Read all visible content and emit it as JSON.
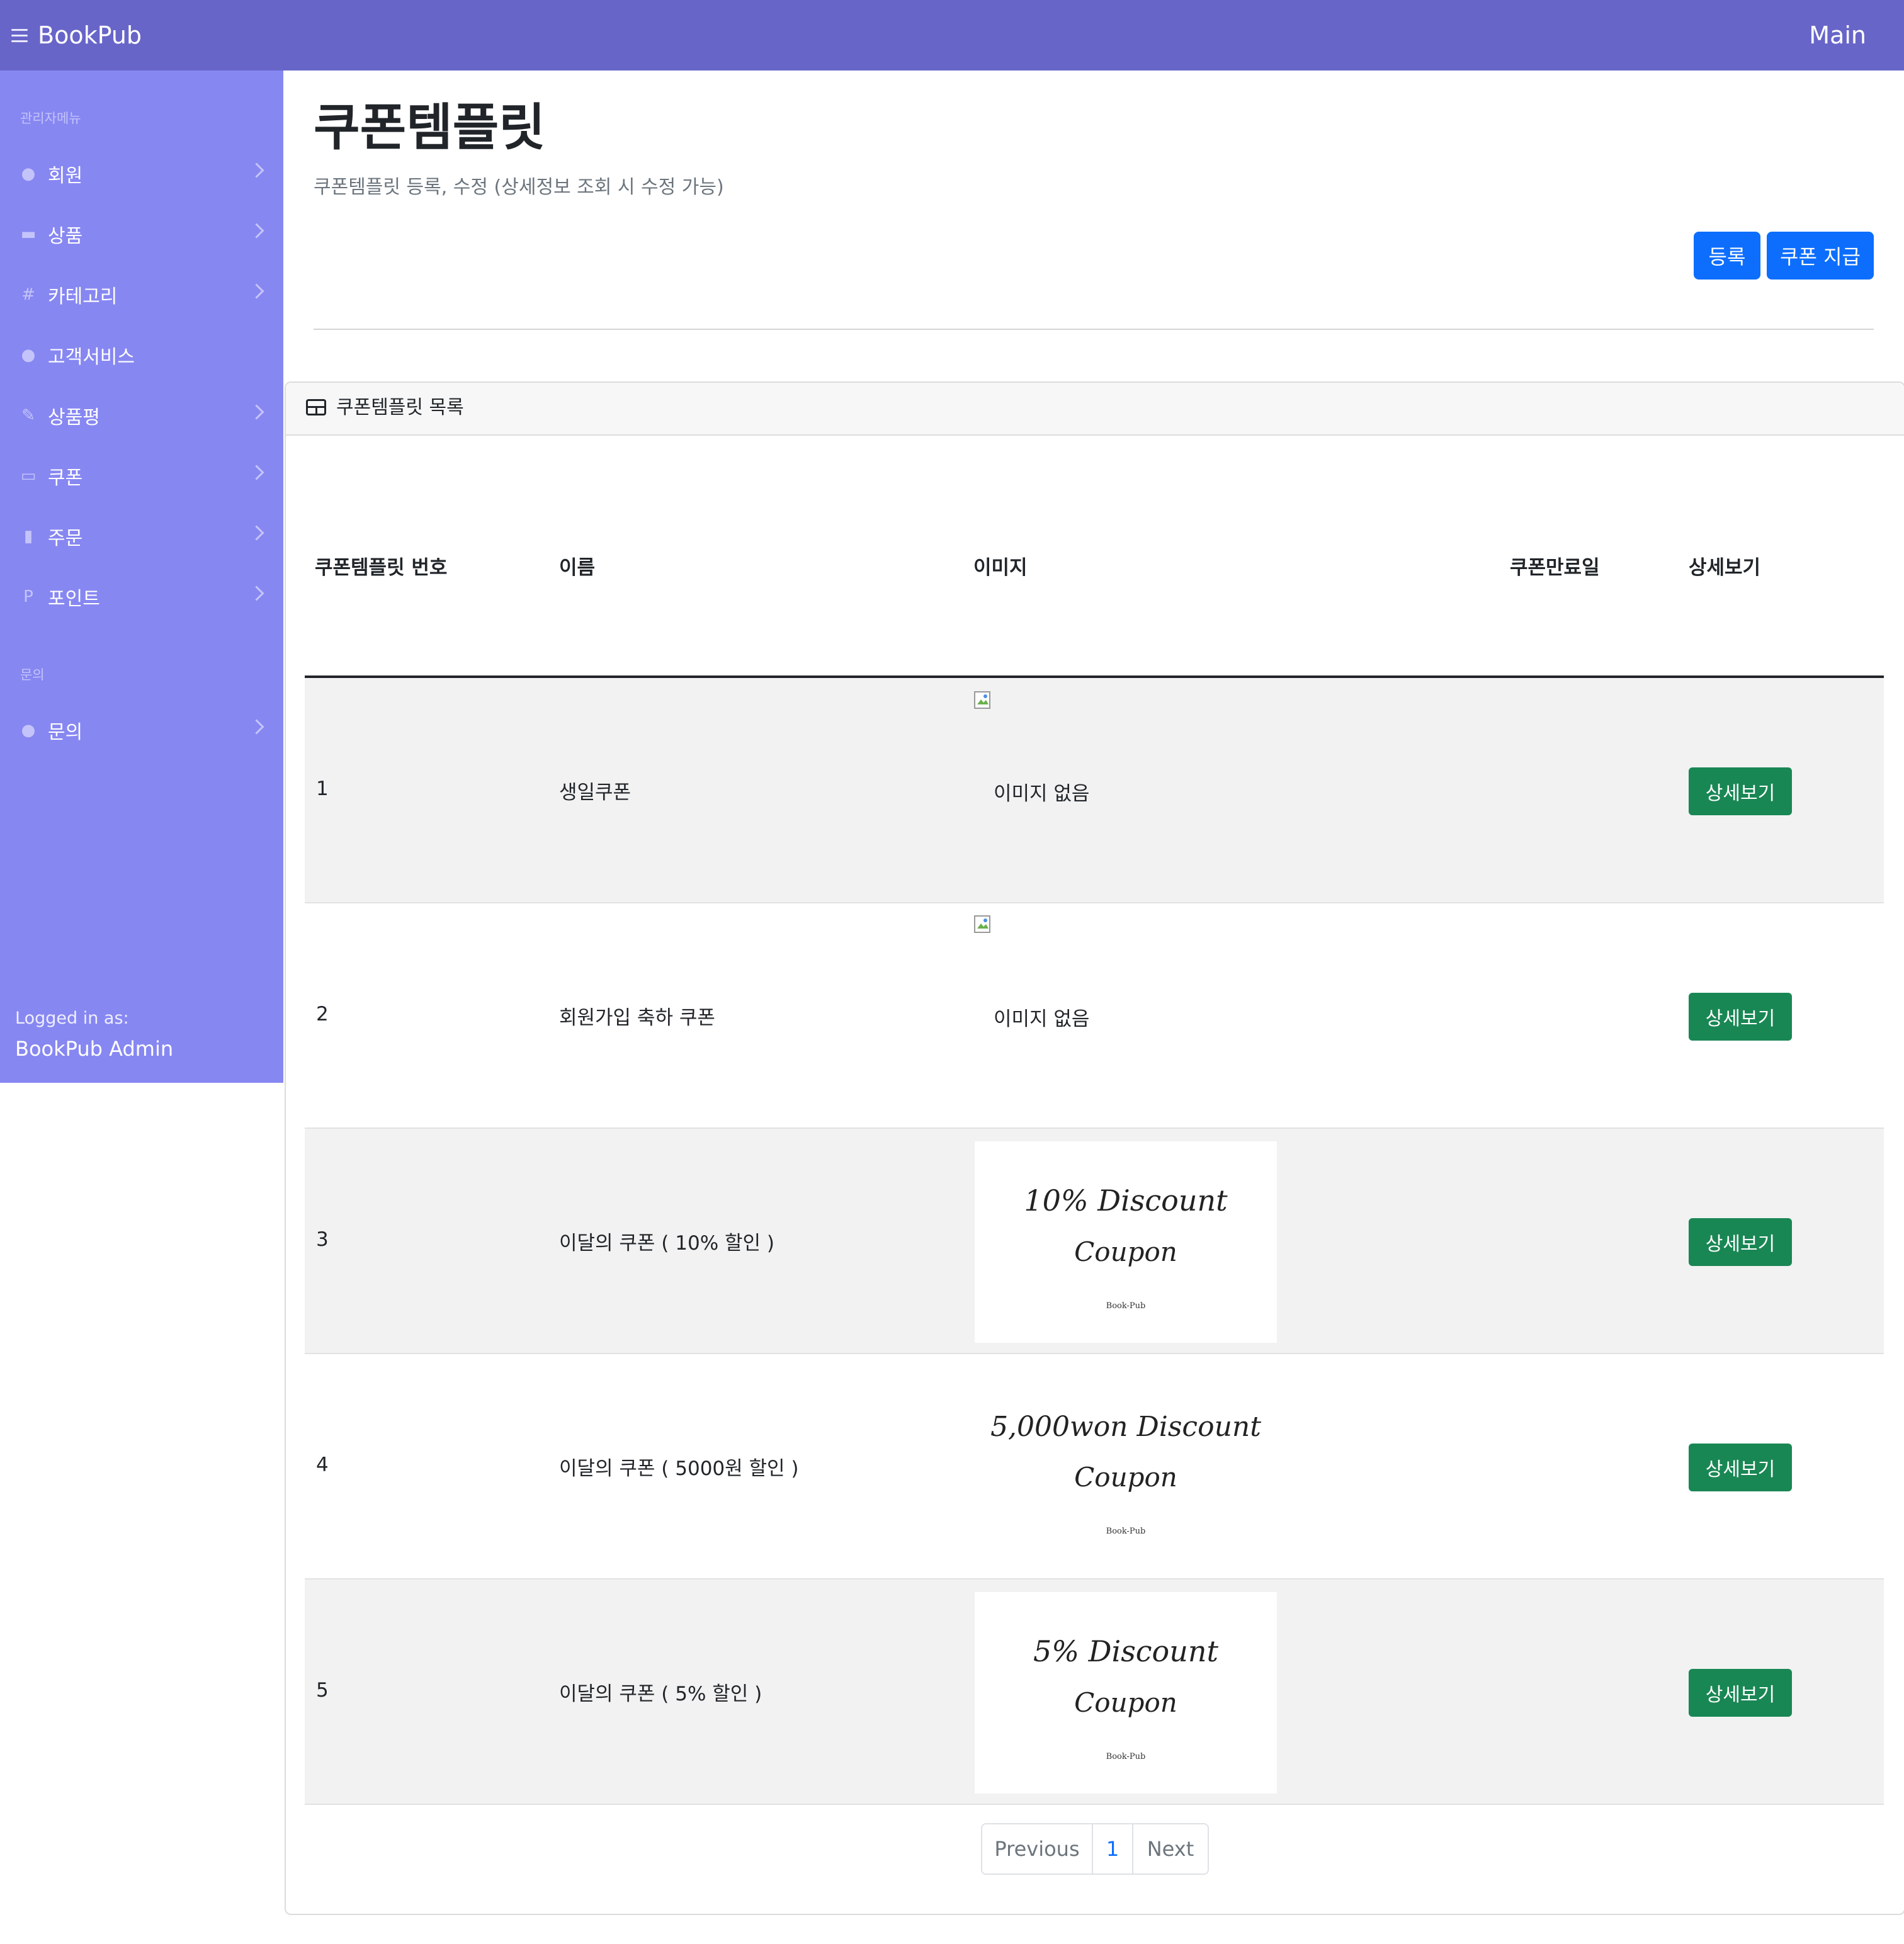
{
  "topbar": {
    "brand": "BookPub",
    "main_link": "Main"
  },
  "sidebar": {
    "heading_admin": "관리자메뉴",
    "items": [
      {
        "label": "회원",
        "icon": "user-circle-icon",
        "glyph": "●"
      },
      {
        "label": "상품",
        "icon": "book-open-icon",
        "glyph": "▬"
      },
      {
        "label": "카테고리",
        "icon": "hash-icon",
        "glyph": "#"
      },
      {
        "label": "고객서비스",
        "icon": "info-icon",
        "glyph": "●"
      },
      {
        "label": "상품평",
        "icon": "pencil-icon",
        "glyph": "✎"
      },
      {
        "label": "쿠폰",
        "icon": "credit-card-icon",
        "glyph": "▭"
      },
      {
        "label": "주문",
        "icon": "clipboard-icon",
        "glyph": "▮"
      },
      {
        "label": "포인트",
        "icon": "letter-p-icon",
        "glyph": "P"
      }
    ],
    "heading_inquiry": "문의",
    "inquiry_item": {
      "label": "문의",
      "icon": "question-circle-icon",
      "glyph": "●"
    },
    "logged_in_label": "Logged in as:",
    "logged_in_user": "BookPub Admin"
  },
  "header": {
    "title": "쿠폰템플릿",
    "subtitle": "쿠폰템플릿 등록, 수정 (상세정보 조회 시 수정 가능)",
    "register_button": "등록",
    "issue_button": "쿠폰 지급"
  },
  "card": {
    "title": "쿠폰템플릿 목록"
  },
  "table": {
    "headers": [
      "쿠폰템플릿 번호",
      "이름",
      "이미지",
      "쿠폰만료일",
      "상세보기"
    ],
    "rows": [
      {
        "num": "1",
        "name": "생일쿠폰",
        "image_text": "이미지 없음",
        "detail": "상세보기"
      },
      {
        "num": "2",
        "name": "회원가입 축하 쿠폰",
        "image_text": "이미지 없음",
        "detail": "상세보기"
      },
      {
        "num": "3",
        "name": "이달의 쿠폰 ( 10% 할인 )",
        "image_line1": "10% Discount",
        "image_line2": "Coupon",
        "image_brand": "Book-Pub",
        "detail": "상세보기"
      },
      {
        "num": "4",
        "name": "이달의 쿠폰 ( 5000원 할인 )",
        "image_line1": "5,000won Discount",
        "image_line2": "Coupon",
        "image_brand": "Book-Pub",
        "detail": "상세보기"
      },
      {
        "num": "5",
        "name": "이달의 쿠폰 ( 5% 할인 )",
        "image_line1": "5% Discount",
        "image_line2": "Coupon",
        "image_brand": "Book-Pub",
        "detail": "상세보기"
      }
    ]
  },
  "pagination": {
    "previous": "Previous",
    "current": "1",
    "next": "Next"
  },
  "colors": {
    "navbar": "#6865c9",
    "sidebar": "#8787f2",
    "primary": "#0d6efd",
    "success": "#198754"
  }
}
